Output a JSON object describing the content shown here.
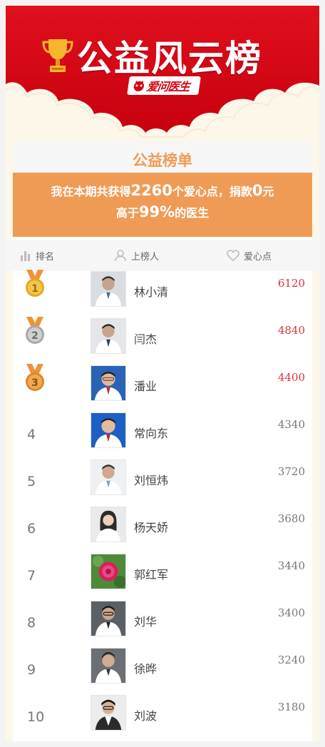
{
  "banner": {
    "title": "公益风云榜",
    "logo_text": "爱问医生"
  },
  "card": {
    "title": "公益榜单",
    "summary": {
      "l1_prefix": "我在本期共获得",
      "points": "2260",
      "l1_mid": "个爱心点，捐款",
      "donation": "0",
      "l1_suffix": "元",
      "l2_prefix": "高于",
      "percent": "99%",
      "l2_suffix": "的医生"
    },
    "columns": {
      "rank": "排名",
      "person": "上榜人",
      "points": "爱心点"
    }
  },
  "ranking": [
    {
      "rank": "1",
      "name": "林小清",
      "points": "6120"
    },
    {
      "rank": "2",
      "name": "闫杰",
      "points": "4840"
    },
    {
      "rank": "3",
      "name": "潘业",
      "points": "4400"
    },
    {
      "rank": "4",
      "name": "常向东",
      "points": "4340"
    },
    {
      "rank": "5",
      "name": "刘恒炜",
      "points": "3720"
    },
    {
      "rank": "6",
      "name": "杨天娇",
      "points": "3680"
    },
    {
      "rank": "7",
      "name": "郭红军",
      "points": "3440"
    },
    {
      "rank": "8",
      "name": "刘华",
      "points": "3400"
    },
    {
      "rank": "9",
      "name": "徐晔",
      "points": "3240"
    },
    {
      "rank": "10",
      "name": "刘波",
      "points": "3180"
    }
  ],
  "colors": {
    "brand_red": "#d7000f",
    "accent_orange": "#ef9b55",
    "top_points": "#e0323c"
  },
  "icons": {
    "trophy": "trophy-icon",
    "rank": "bar-chart-icon",
    "person": "person-icon",
    "points": "heart-icon"
  }
}
